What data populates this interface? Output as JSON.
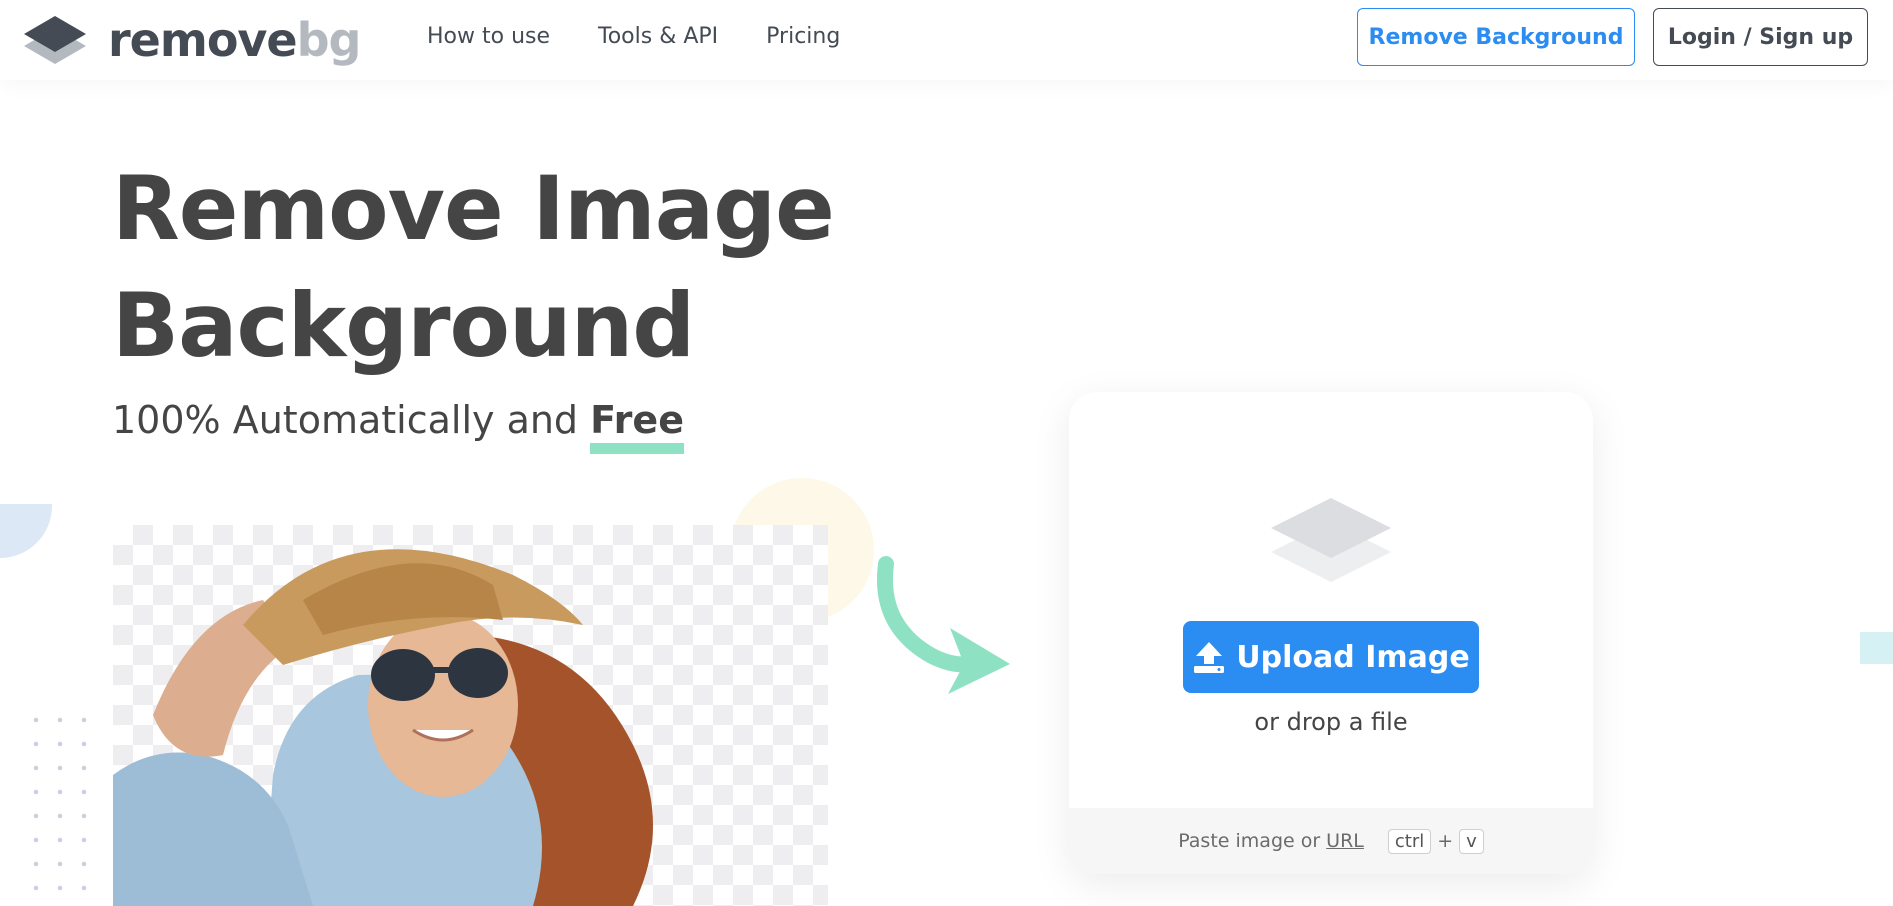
{
  "brand": {
    "name_part1": "remove",
    "name_part2": "bg",
    "accent": "#2b8cf2",
    "free_underline": "#8fe1c3"
  },
  "nav": {
    "items": [
      {
        "label": "How to use"
      },
      {
        "label": "Tools & API"
      },
      {
        "label": "Pricing"
      }
    ]
  },
  "header": {
    "remove_bg_label": "Remove Background",
    "login_label": "Login / Sign up"
  },
  "hero": {
    "title_line1": "Remove Image",
    "title_line2": "Background",
    "subtitle_prefix": "100% Automatically and",
    "subtitle_emphasis": "Free"
  },
  "upload": {
    "button_label": "Upload Image",
    "drop_text": "or drop a file",
    "paste_prefix": "Paste image or",
    "paste_link": "URL",
    "key_ctrl": "ctrl",
    "key_plus": "+",
    "key_v": "v"
  },
  "icons": {
    "logo": "layers-icon",
    "upload": "upload-icon",
    "card": "layers-icon",
    "arrow": "curved-arrow-icon"
  }
}
